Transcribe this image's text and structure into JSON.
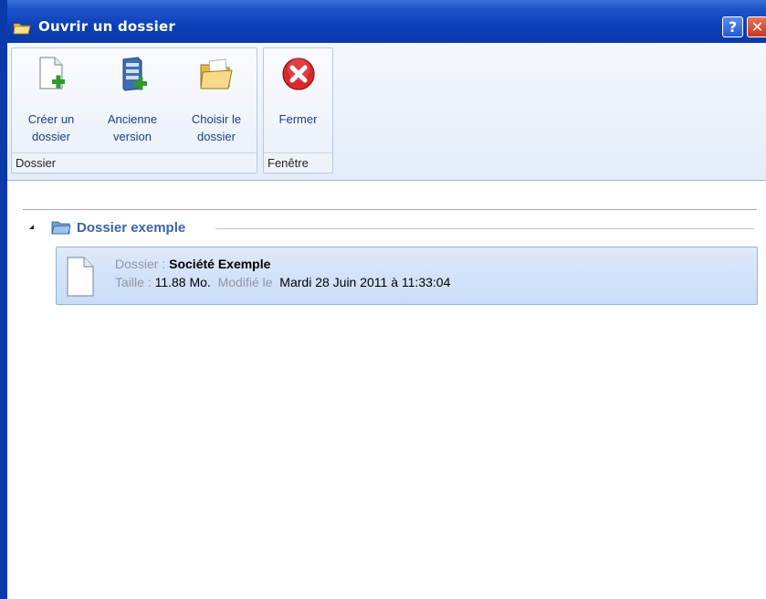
{
  "window": {
    "title": "Ouvrir un dossier",
    "help_label": "?",
    "close_label": "✕"
  },
  "ribbon": {
    "groups": [
      {
        "label": "Dossier",
        "buttons": [
          {
            "line1": "Créer un",
            "line2": "dossier",
            "icon": "new-document-icon"
          },
          {
            "line1": "Ancienne",
            "line2": "version",
            "icon": "server-add-icon"
          },
          {
            "line1": "Choisir le",
            "line2": "dossier",
            "icon": "open-folder-icon"
          }
        ]
      },
      {
        "label": "Fenêtre",
        "buttons": [
          {
            "line1": "Fermer",
            "line2": "",
            "icon": "close-red-icon"
          }
        ]
      }
    ]
  },
  "list": {
    "group_title": "Dossier exemple",
    "items": [
      {
        "dossier_label": "Dossier :",
        "dossier_value": "Société Exemple",
        "taille_label": "Taille :",
        "taille_value": "11.88 Mo.",
        "modifie_label": "Modifié le",
        "modifie_value": "Mardi 28 Juin 2011 à 11:33:04"
      }
    ]
  },
  "colors": {
    "titlebar": "#0a3fb8",
    "ribbon_text": "#1c3d8a",
    "group_title": "#3b63a8",
    "selection": "#c9dcf7"
  }
}
